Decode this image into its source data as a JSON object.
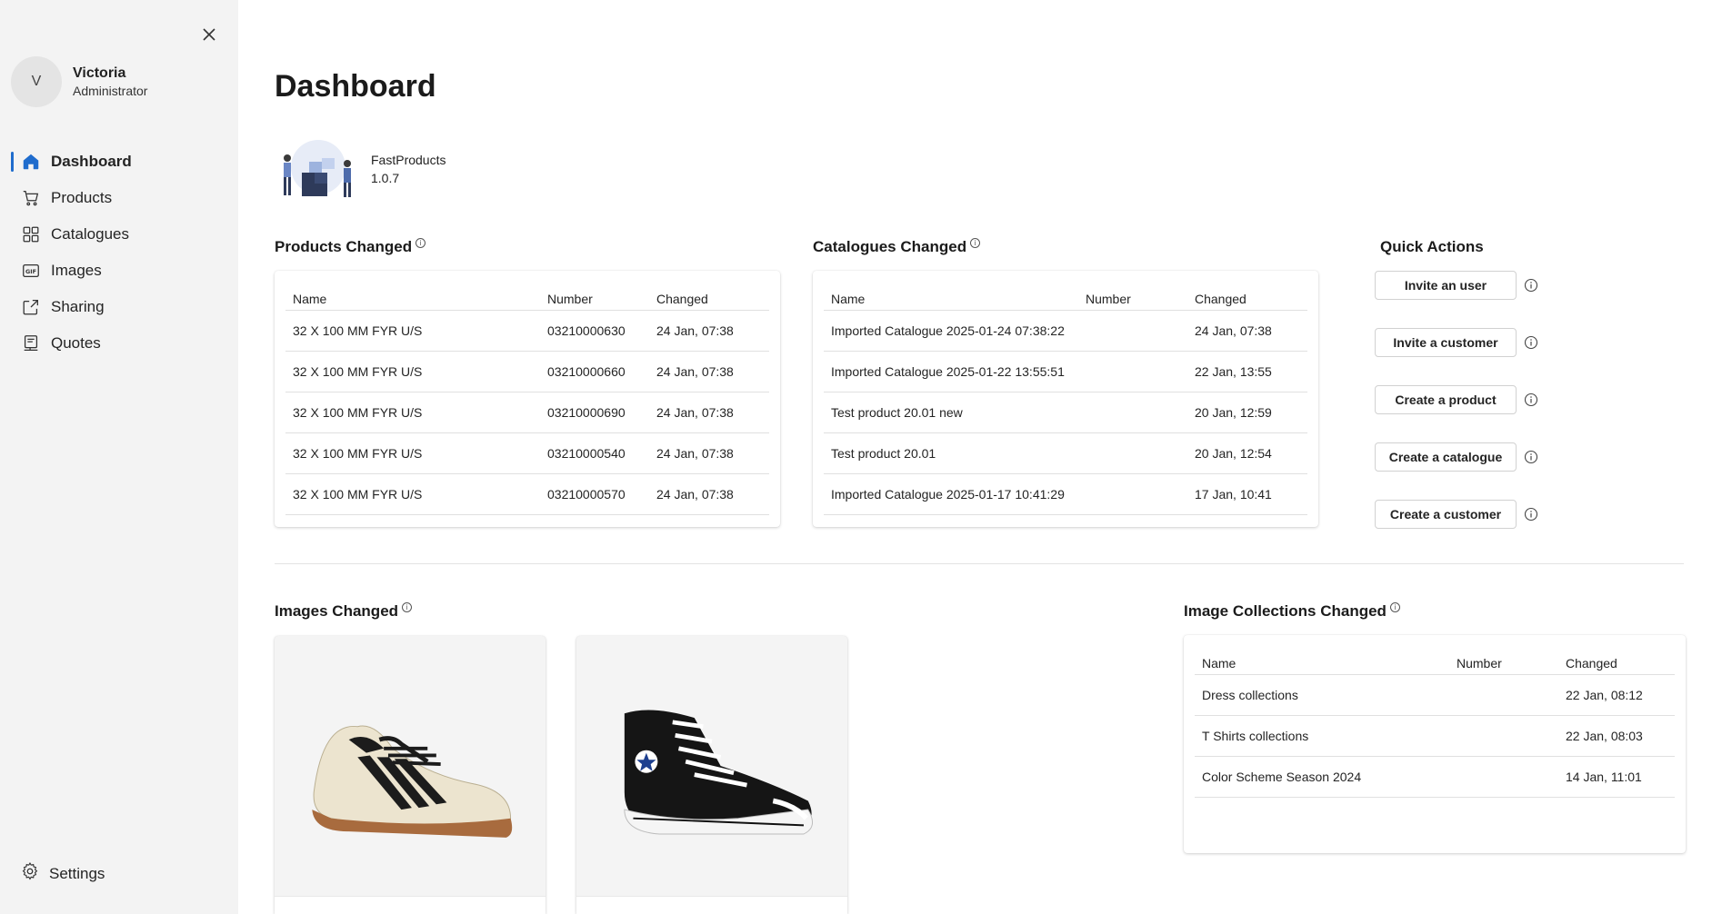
{
  "sidebar": {
    "user": {
      "initial": "V",
      "name": "Victoria",
      "role": "Administrator"
    },
    "nav": [
      {
        "label": "Dashboard",
        "icon": "home-icon",
        "active": true
      },
      {
        "label": "Products",
        "icon": "cart-icon"
      },
      {
        "label": "Catalogues",
        "icon": "grid-icon"
      },
      {
        "label": "Images",
        "icon": "gif-icon"
      },
      {
        "label": "Sharing",
        "icon": "share-icon"
      },
      {
        "label": "Quotes",
        "icon": "quote-icon"
      }
    ],
    "settings_label": "Settings"
  },
  "page": {
    "title": "Dashboard"
  },
  "app": {
    "name": "FastProducts",
    "version": "1.0.7"
  },
  "products_changed": {
    "title": "Products Changed",
    "columns": [
      "Name",
      "Number",
      "Changed"
    ],
    "rows": [
      [
        "32 X 100 MM FYR U/S",
        "03210000630",
        "24 Jan, 07:38"
      ],
      [
        "32 X 100 MM FYR U/S",
        "03210000660",
        "24 Jan, 07:38"
      ],
      [
        "32 X 100 MM FYR U/S",
        "03210000690",
        "24 Jan, 07:38"
      ],
      [
        "32 X 100 MM FYR U/S",
        "03210000540",
        "24 Jan, 07:38"
      ],
      [
        "32 X 100 MM FYR U/S",
        "03210000570",
        "24 Jan, 07:38"
      ]
    ]
  },
  "catalogues_changed": {
    "title": "Catalogues Changed",
    "columns": [
      "Name",
      "Number",
      "Changed"
    ],
    "rows": [
      [
        "Imported Catalogue 2025-01-24 07:38:22",
        "",
        "24 Jan, 07:38"
      ],
      [
        "Imported Catalogue 2025-01-22 13:55:51",
        "",
        "22 Jan, 13:55"
      ],
      [
        "Test product 20.01 new",
        "",
        "20 Jan, 12:59"
      ],
      [
        "Test product 20.01",
        "",
        "20 Jan, 12:54"
      ],
      [
        "Imported Catalogue 2025-01-17 10:41:29",
        "",
        "17 Jan, 10:41"
      ]
    ]
  },
  "quick_actions": {
    "title": "Quick Actions",
    "buttons": [
      "Invite an user",
      "Invite a customer",
      "Create a product",
      "Create a catalogue",
      "Create a customer"
    ]
  },
  "images_changed": {
    "title": "Images Changed"
  },
  "image_collections_changed": {
    "title": "Image Collections Changed",
    "columns": [
      "Name",
      "Number",
      "Changed"
    ],
    "rows": [
      [
        "Dress collections",
        "",
        "22 Jan, 08:12"
      ],
      [
        "T Shirts collections",
        "",
        "22 Jan, 08:03"
      ],
      [
        "Color Scheme Season 2024",
        "",
        "14 Jan, 11:01"
      ]
    ]
  },
  "colors": {
    "accent": "#1f6ccd",
    "sidebar_bg": "#f3f3f3"
  }
}
